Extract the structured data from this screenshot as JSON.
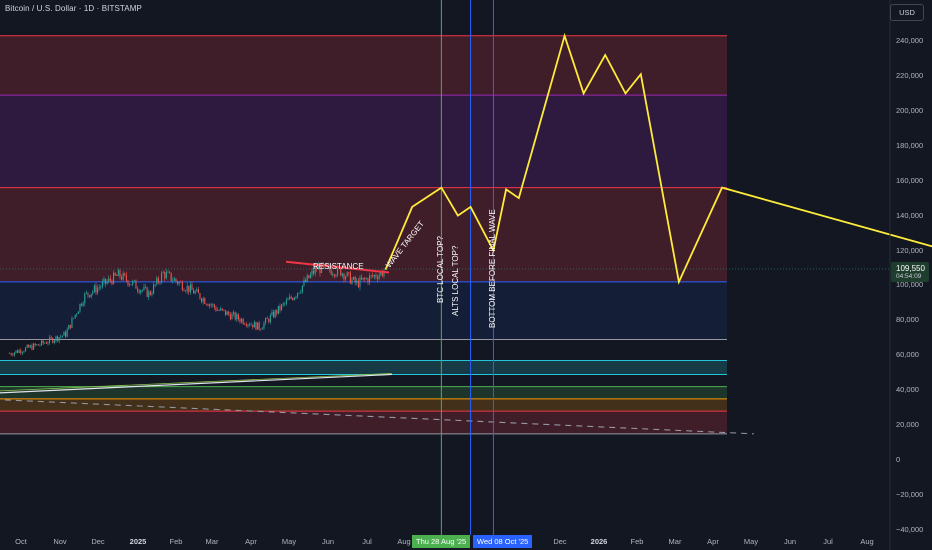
{
  "header": {
    "symbol_title": "Bitcoin / U.S. Dollar · 1D · BITSTAMP",
    "currency": "USD"
  },
  "price_label": {
    "price": "109,550",
    "countdown": "04:54:09"
  },
  "colors": {
    "background": "#131722",
    "projection": "#ffeb3b",
    "red_zone": "#f23645",
    "purple_line": "#9c27b0",
    "blue_zone": "#1e3a8a",
    "green_vline": "#4caf50",
    "blue_vline": "#2962ff"
  },
  "annotations": {
    "resistance": "RESISTANCE",
    "wave_target": "WAVE TARGET",
    "btc_local_top": "BTC LOCAL TOP?",
    "alts_local_top": "ALTS LOCAL TOP?",
    "bottom_before_final": "BOTTOM BEFORE FINAL WAVE"
  },
  "date_markers": {
    "green": "Thu 28 Aug '25",
    "blue": "Wed 08 Oct '25"
  },
  "chart_data": {
    "type": "line",
    "title": "Bitcoin / U.S. Dollar · 1D · BITSTAMP",
    "ylim": [
      -40000,
      260000
    ],
    "y_ticks": [
      "240,000",
      "220,000",
      "200,000",
      "180,000",
      "160,000",
      "140,000",
      "120,000",
      "100,000",
      "80,000",
      "60,000",
      "40,000",
      "20,000",
      "0",
      "−20,000",
      "−40,000"
    ],
    "x_ticks": [
      "Oct",
      "Nov",
      "Dec",
      "2025",
      "Feb",
      "Mar",
      "Apr",
      "May",
      "Jun",
      "Jul",
      "Aug",
      "Nov",
      "Dec",
      "2026",
      "Feb",
      "Mar",
      "Apr",
      "May",
      "Jun",
      "Jul",
      "Aug"
    ],
    "horizontal_levels": [
      243000,
      209000,
      156000,
      102000,
      69000,
      57000,
      49000,
      42000,
      35000,
      28000,
      15000
    ],
    "zones": [
      {
        "from": 209000,
        "to": 243000,
        "color": "#f23645"
      },
      {
        "from": 156000,
        "to": 209000,
        "color": "#9c27b0"
      },
      {
        "from": 102000,
        "to": 156000,
        "color": "#f23645"
      },
      {
        "from": 69000,
        "to": 102000,
        "color": "#1e3a8a"
      },
      {
        "from": 49000,
        "to": 57000,
        "color": "#26c6da"
      },
      {
        "from": 35000,
        "to": 42000,
        "color": "#4caf50"
      },
      {
        "from": 28000,
        "to": 35000,
        "color": "#ff9800"
      },
      {
        "from": 15000,
        "to": 28000,
        "color": "#f23645"
      }
    ],
    "series": [
      {
        "name": "BTC",
        "x": [
          "2024-09-22",
          "2024-10-15",
          "2024-11-05",
          "2024-11-20",
          "2024-12-17",
          "2025-01-10",
          "2025-01-21",
          "2025-02-15",
          "2025-03-05",
          "2025-04-07",
          "2025-05-05",
          "2025-05-22",
          "2025-06-10",
          "2025-06-22",
          "2025-07-14"
        ],
        "values": [
          61000,
          66000,
          72000,
          94000,
          106000,
          95000,
          107000,
          96000,
          86000,
          76000,
          95000,
          110000,
          108000,
          101000,
          108000
        ]
      },
      {
        "name": "Projection",
        "x": [
          "2025-07-15",
          "2025-08-05",
          "2025-08-28",
          "2025-09-10",
          "2025-09-20",
          "2025-10-08",
          "2025-10-18",
          "2025-10-28",
          "2025-12-03",
          "2025-12-18",
          "2026-01-04",
          "2026-01-20",
          "2026-02-01",
          "2026-03-03",
          "2026-04-06",
          "2027-08-01"
        ],
        "values": [
          109000,
          145000,
          156000,
          140000,
          145000,
          120000,
          155000,
          150000,
          243000,
          210000,
          232000,
          210000,
          221000,
          102000,
          156000,
          58000
        ]
      },
      {
        "name": "Resistance",
        "x": [
          "2025-05-01",
          "2025-07-20"
        ],
        "values": [
          113000,
          108000
        ]
      },
      {
        "name": "Long-term trend",
        "x": [
          "2024-09-01",
          "2025-07-20"
        ],
        "values": [
          38000,
          49000
        ]
      },
      {
        "name": "Dashed trend",
        "x": [
          "2024-09-01",
          "2026-05-01"
        ],
        "values": [
          35000,
          15000
        ]
      }
    ],
    "vertical_markers": [
      {
        "date": "2025-08-28",
        "color": "#4caf50"
      },
      {
        "date": "2025-09-20",
        "color": "#2962ff"
      },
      {
        "date": "2025-10-08",
        "color": "#2962ff"
      }
    ],
    "grid": false,
    "legend": "none"
  }
}
